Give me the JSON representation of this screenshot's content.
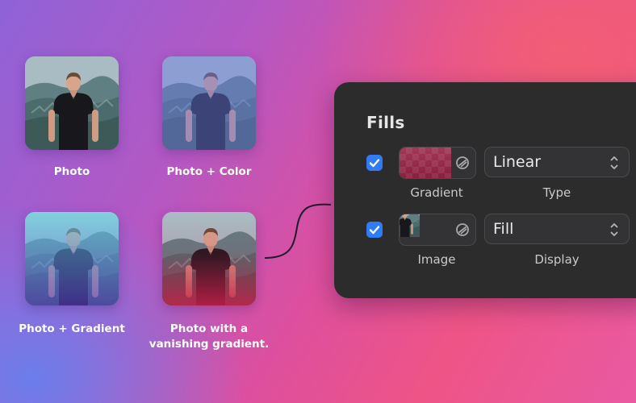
{
  "examples": [
    {
      "caption": "Photo"
    },
    {
      "caption": "Photo + Color"
    },
    {
      "caption": "Photo + Gradient"
    },
    {
      "caption": "Photo with a vanishing gradient."
    }
  ],
  "panel": {
    "title": "Fills",
    "fills": [
      {
        "checked": true,
        "preview_label": "Gradient",
        "select_value": "Linear",
        "select_label": "Type"
      },
      {
        "checked": true,
        "preview_label": "Image",
        "select_value": "Fill",
        "select_label": "Display"
      }
    ]
  },
  "colors": {
    "checkbox": "#2f7cf6",
    "panel_bg": "#2c2c2d",
    "gradient_swatch": "#9b2a4a"
  },
  "icons": {
    "checkbox": "checkmark-icon",
    "link": "link-icon",
    "select": "chevron-updown-icon"
  }
}
